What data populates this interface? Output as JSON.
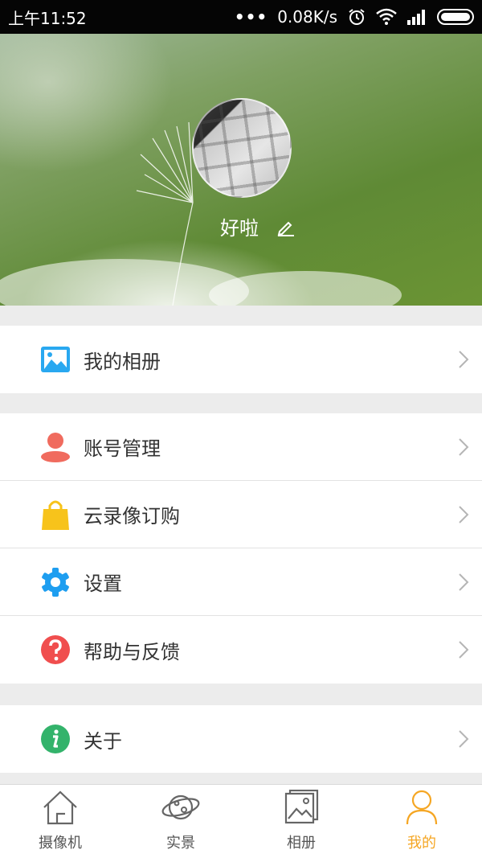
{
  "status_bar": {
    "time": "上午11:52",
    "network_speed": "0.08K/s",
    "icons": [
      "more-dots-icon",
      "alarm-icon",
      "wifi-icon",
      "signal-icon",
      "battery-icon"
    ]
  },
  "profile": {
    "username": "好啦",
    "avatar": "keyboard-photo",
    "edit_icon": "pencil-icon"
  },
  "menu": {
    "album": {
      "label": "我的相册",
      "icon": "image-icon",
      "color": "#29a8f0"
    },
    "account": {
      "label": "账号管理",
      "icon": "person-icon",
      "color": "#f06b5e"
    },
    "cloud": {
      "label": "云录像订购",
      "icon": "shopping-bag-icon",
      "color": "#f7c31b"
    },
    "settings": {
      "label": "设置",
      "icon": "gear-icon",
      "color": "#1e9ef0"
    },
    "help": {
      "label": "帮助与反馈",
      "icon": "question-icon",
      "color": "#f04e4e"
    },
    "about": {
      "label": "关于",
      "icon": "info-icon",
      "color": "#33b36b"
    }
  },
  "bottom_nav": {
    "items": [
      {
        "label": "摄像机",
        "icon": "home-icon",
        "active": false
      },
      {
        "label": "实景",
        "icon": "planet-icon",
        "active": false
      },
      {
        "label": "相册",
        "icon": "gallery-icon",
        "active": false
      },
      {
        "label": "我的",
        "icon": "person-outline-icon",
        "active": true
      }
    ],
    "active_color": "#f5a623"
  }
}
